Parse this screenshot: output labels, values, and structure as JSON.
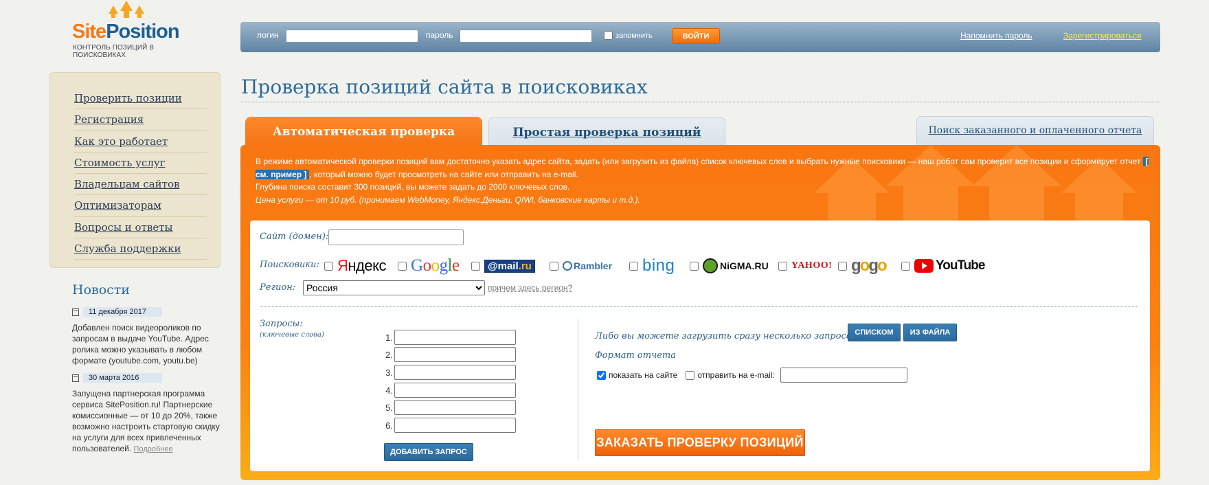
{
  "logo": {
    "part1": "Site",
    "part2": "Position",
    "tagline": "КОНТРОЛЬ ПОЗИЦИЙ В ПОИСКОВИКАХ"
  },
  "login": {
    "login_label": "логин",
    "password_label": "пароль",
    "remember_label": "запомнить",
    "enter_button": "ВОЙТИ",
    "remind_link": "Напомнить пароль",
    "register_link": "Зарегистрироваться"
  },
  "menu": {
    "items": [
      "Проверить позиции",
      "Регистрация",
      "Как это работает",
      "Стоимость услуг",
      "Владельцам сайтов",
      "Оптимизаторам",
      "Вопросы и ответы",
      "Служба поддержки"
    ]
  },
  "news": {
    "title": "Новости",
    "items": [
      {
        "date": "11 декабря 2017",
        "text": "Добавлен поиск видеороликов по запросам в выдаче YouTube. Адрес ролика можно указывать в любом формате (youtube.com, youtu.be)"
      },
      {
        "date": "30 марта 2016",
        "text": "Запущена партнерская программа сервиса SitePosition.ru! Партнерские комиссионные — от 10 до 20%, также возможно настроить стартовую скидку на услуги для всех привлеченных пользователей.",
        "more": "Подробнее"
      }
    ]
  },
  "main": {
    "title": "Проверка позиций сайта в поисковиках",
    "tabs": {
      "auto": "Автоматическая проверка",
      "simple": "Простая проверка позиций",
      "report": "Поиск заказанного и оплаченного отчета"
    },
    "intro": {
      "line1_a": "В режиме автоматической проверки позиций вам достаточно указать адрес сайта, задать (или загрузить из файла) список ключевых слов и выбрать нужные поисковики — наш робот сам проверит все позиции и сформирует отчет ",
      "example": "[ см. пример ]",
      "line1_b": ", который можно будет просмотреть на сайте или отправить на e-mail.",
      "line2": "Глубина поиска составит 300 позиций, вы можете задать до 2000 ключевых слов.",
      "line3": "Цена услуги — от 10 руб. (принимаем WebMoney, Яндекс.Деньги, QIWI, банковские карты и т.д.)."
    }
  },
  "form": {
    "domain_label": "Сайт (домен):",
    "engines_label": "Поисковики:",
    "engines": {
      "yandex_a": "Я",
      "yandex_b": "ндекс",
      "google": "Google",
      "mail_a": "@mail",
      "mail_b": ".ru",
      "rambler": "Rambler",
      "bing": "bing",
      "nigma": "NiGMA.RU",
      "yahoo": "YAHOO!",
      "gogo_a": "g",
      "gogo_b": "o",
      "gogo_c": "g",
      "gogo_d": "o",
      "youtube": "YouTube"
    },
    "region_label": "Регион:",
    "region_value": "Россия",
    "region_help": "причем здесь регион?",
    "queries_label": "Запросы:",
    "queries_sublabel": "(ключевые слова)",
    "query_numbers": [
      "1.",
      "2.",
      "3.",
      "4.",
      "5.",
      "6."
    ],
    "add_query_button": "ДОБАВИТЬ ЗАПРОС",
    "upload_label": "Либо вы можете загрузить сразу несколько запросов:",
    "list_button": "СПИСКОМ",
    "file_button": "ИЗ ФАЙЛА",
    "format_label": "Формат отчета",
    "show_on_site_label": "показать на сайте",
    "send_email_label": "отправить на e-mail:",
    "order_button": "ЗАКАЗАТЬ ПРОВЕРКУ ПОЗИЦИЙ"
  },
  "colors": {
    "orange": "#f97612",
    "blue": "#2d6b9a",
    "menu_bg": "#ebe4ce"
  }
}
